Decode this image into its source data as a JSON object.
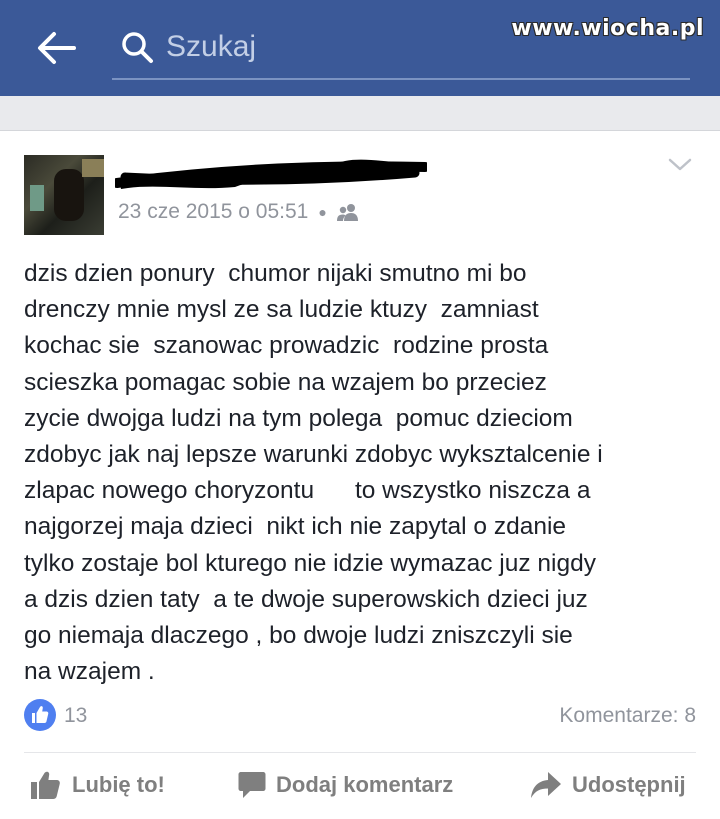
{
  "header": {
    "search_placeholder": "Szukaj",
    "watermark": "www.wiocha.pl",
    "bar_color": "#3b5998"
  },
  "post": {
    "author_redacted": true,
    "timestamp": "23 cze 2015 o 05:51",
    "audience_icon": "friends-icon",
    "lines": [
      "dzis dzien ponury  chumor nijaki smutno mi bo",
      "drenczy mnie mysl ze sa ludzie ktuzy  zamniast",
      "kochac sie  szanowac prowadzic  rodzine prosta",
      "scieszka pomagac sobie na wzajem bo przeciez",
      "zycie dwojga ludzi na tym polega  pomuc dzieciom",
      "zdobyc jak naj lepsze warunki zdobyc wyksztalcenie i",
      "zlapac nowego choryzontu      to wszystko niszcza a",
      "najgorzej maja dzieci  nikt ich nie zapytal o zdanie",
      "tylko zostaje bol kturego nie idzie wymazac juz nigdy",
      "a dzis dzien taty  a te dwoje superowskich dzieci juz",
      "go niemaja dlaczego , bo dwoje ludzi zniszczyli sie",
      "na wzajem ."
    ],
    "likes_count": "13",
    "comments_label": "Komentarze: 8"
  },
  "actions": {
    "like_label": "Lubię to!",
    "comment_label": "Dodaj komentarz",
    "share_label": "Udostępnij"
  },
  "colors": {
    "text": "#1d2129",
    "meta": "#90949c",
    "like_badge": "#4f7ff0",
    "action": "#7f7f7f"
  }
}
